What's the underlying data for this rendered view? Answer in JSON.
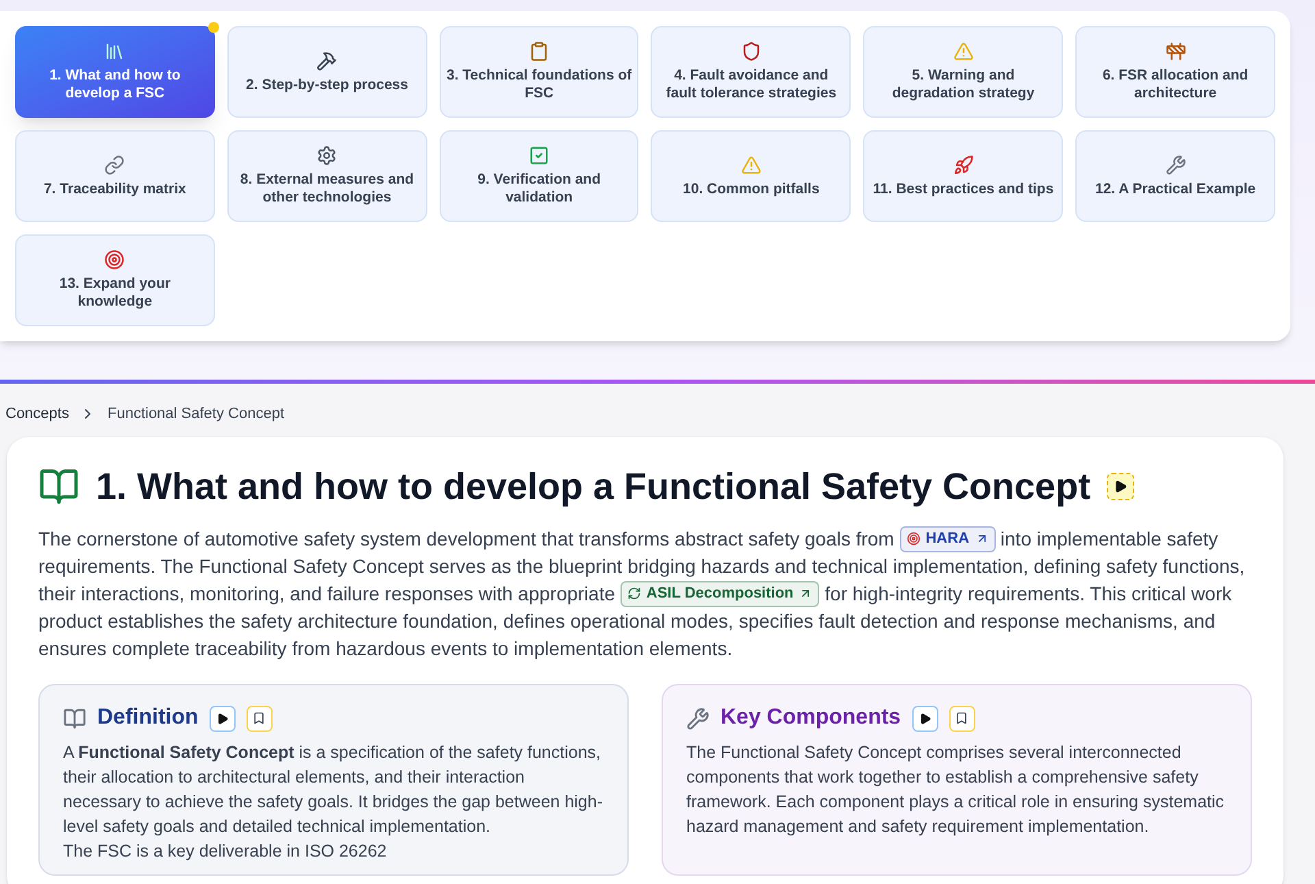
{
  "topics": [
    {
      "label": "1. What and how to develop a FSC",
      "selected": true,
      "marked": true
    },
    {
      "label": "2. Step-by-step process",
      "selected": false,
      "marked": false
    },
    {
      "label": "3. Technical foundations of FSC",
      "selected": false,
      "marked": false
    },
    {
      "label": "4. Fault avoidance and fault tolerance strategies",
      "selected": false,
      "marked": false
    },
    {
      "label": "5. Warning and degradation strategy",
      "selected": false,
      "marked": false
    },
    {
      "label": "6. FSR allocation and architecture",
      "selected": false,
      "marked": false
    },
    {
      "label": "7. Traceability matrix",
      "selected": false,
      "marked": false
    },
    {
      "label": "8. External measures and other technologies",
      "selected": false,
      "marked": false
    },
    {
      "label": "9. Verification and validation",
      "selected": false,
      "marked": false
    },
    {
      "label": "10. Common pitfalls",
      "selected": false,
      "marked": false
    },
    {
      "label": "11. Best practices and tips",
      "selected": false,
      "marked": false
    },
    {
      "label": "12. A Practical Example",
      "selected": false,
      "marked": false
    },
    {
      "label": "13. Expand your knowledge",
      "selected": false,
      "marked": false
    }
  ],
  "breadcrumb": [
    "Concepts",
    "Functional Safety Concept"
  ],
  "article": {
    "title": "1. What and how to develop a Functional Safety Concept",
    "intro": [
      {
        "kind": "text",
        "text": "The cornerstone of automotive safety system development that transforms abstract safety goals from"
      },
      {
        "kind": "link",
        "text": "HARA",
        "color": "#1e40af"
      },
      {
        "kind": "text",
        "text": "into implementable safety requirements. The Functional Safety Concept serves as the blueprint bridging hazards and technical implementation, defining safety functions, their interactions, monitoring, and failure responses with appropriate"
      },
      {
        "kind": "link",
        "text": "ASIL Decomposition",
        "color": "#166534"
      },
      {
        "kind": "text",
        "text": "for high-integrity requirements. This critical work product establishes the safety architecture foundation, defines operational modes, specifies fault detection and response mechanisms, and ensures complete traceability from hazardous events to implementation elements."
      }
    ],
    "sections": [
      {
        "title": "Definition",
        "color": "#1e3a8a",
        "paragraphs": [
          "A **Functional Safety Concept** is a specification of the safety functions, their allocation to architectural elements, and their interaction necessary to achieve the safety goals. It bridges the gap between high-level safety goals and detailed technical implementation.",
          "The FSC is a key deliverable in ISO 26262"
        ]
      },
      {
        "title": "Key Components",
        "color": "#6b21a8",
        "paragraphs": [
          "The Functional Safety Concept comprises several interconnected components that work together to establish a comprehensive safety framework. Each component plays a critical role in ensuring systematic hazard management and safety requirement implementation."
        ]
      }
    ]
  }
}
